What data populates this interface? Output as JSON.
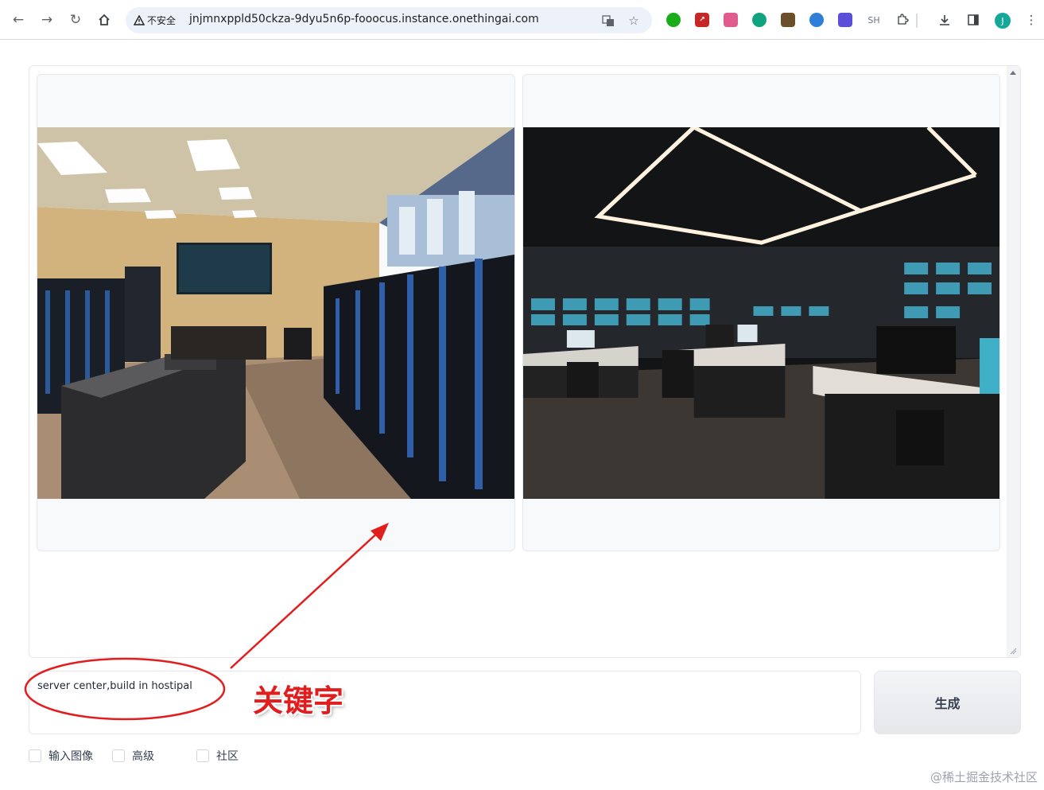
{
  "browser": {
    "security_label": "不安全",
    "url": "jnjmnxppld50ckza-9dyu5n6p-fooocus.instance.onethingai.com",
    "extension_sh_label": "SH",
    "profile_initial": "J"
  },
  "prompt": {
    "value": "server center,build in hostipal"
  },
  "generate_button": {
    "label": "生成"
  },
  "options": [
    {
      "label": "输入图像",
      "checked": false
    },
    {
      "label": "高级",
      "checked": false
    },
    {
      "label": "社区",
      "checked": false
    }
  ],
  "annotation": {
    "label": "关键字",
    "color": "#e21d1d"
  },
  "watermark": "@稀土掘金技术社区"
}
